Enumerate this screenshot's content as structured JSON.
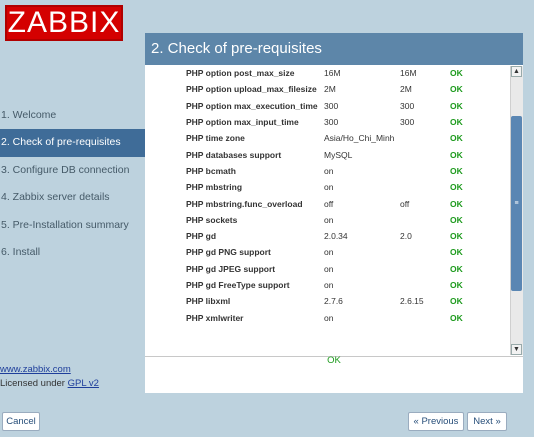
{
  "brand": {
    "logo_text": "ZABBIX",
    "accent": "#d40000"
  },
  "sidebar": {
    "steps": [
      {
        "label": "1. Welcome"
      },
      {
        "label": "2. Check of pre-requisites"
      },
      {
        "label": "3. Configure DB connection"
      },
      {
        "label": "4. Zabbix server details"
      },
      {
        "label": "5. Pre-Installation summary"
      },
      {
        "label": "6. Install"
      }
    ],
    "active_index": 1,
    "site_link": "www.zabbix.com",
    "license_prefix": "Licensed under",
    "license_link": "GPL v2"
  },
  "panel": {
    "title": "2. Check of pre-requisites",
    "rows": [
      {
        "name": "PHP option post_max_size",
        "current": "16M",
        "required": "16M",
        "result": "OK"
      },
      {
        "name": "PHP option upload_max_filesize",
        "current": "2M",
        "required": "2M",
        "result": "OK"
      },
      {
        "name": "PHP option max_execution_time",
        "current": "300",
        "required": "300",
        "result": "OK"
      },
      {
        "name": "PHP option max_input_time",
        "current": "300",
        "required": "300",
        "result": "OK"
      },
      {
        "name": "PHP time zone",
        "current": "Asia/Ho_Chi_Minh",
        "required": "",
        "result": "OK"
      },
      {
        "name": "PHP databases support",
        "current": "MySQL",
        "required": "",
        "result": "OK"
      },
      {
        "name": "PHP bcmath",
        "current": "on",
        "required": "",
        "result": "OK"
      },
      {
        "name": "PHP mbstring",
        "current": "on",
        "required": "",
        "result": "OK"
      },
      {
        "name": "PHP mbstring.func_overload",
        "current": "off",
        "required": "off",
        "result": "OK"
      },
      {
        "name": "PHP sockets",
        "current": "on",
        "required": "",
        "result": "OK"
      },
      {
        "name": "PHP gd",
        "current": "2.0.34",
        "required": "2.0",
        "result": "OK"
      },
      {
        "name": "PHP gd PNG support",
        "current": "on",
        "required": "",
        "result": "OK"
      },
      {
        "name": "PHP gd JPEG support",
        "current": "on",
        "required": "",
        "result": "OK"
      },
      {
        "name": "PHP gd FreeType support",
        "current": "on",
        "required": "",
        "result": "OK"
      },
      {
        "name": "PHP libxml",
        "current": "2.7.6",
        "required": "2.6.15",
        "result": "OK"
      },
      {
        "name": "PHP xmlwriter",
        "current": "on",
        "required": "",
        "result": "OK"
      }
    ],
    "summary": "OK"
  },
  "buttons": {
    "cancel": "Cancel",
    "previous": "« Previous",
    "next": "Next »"
  }
}
